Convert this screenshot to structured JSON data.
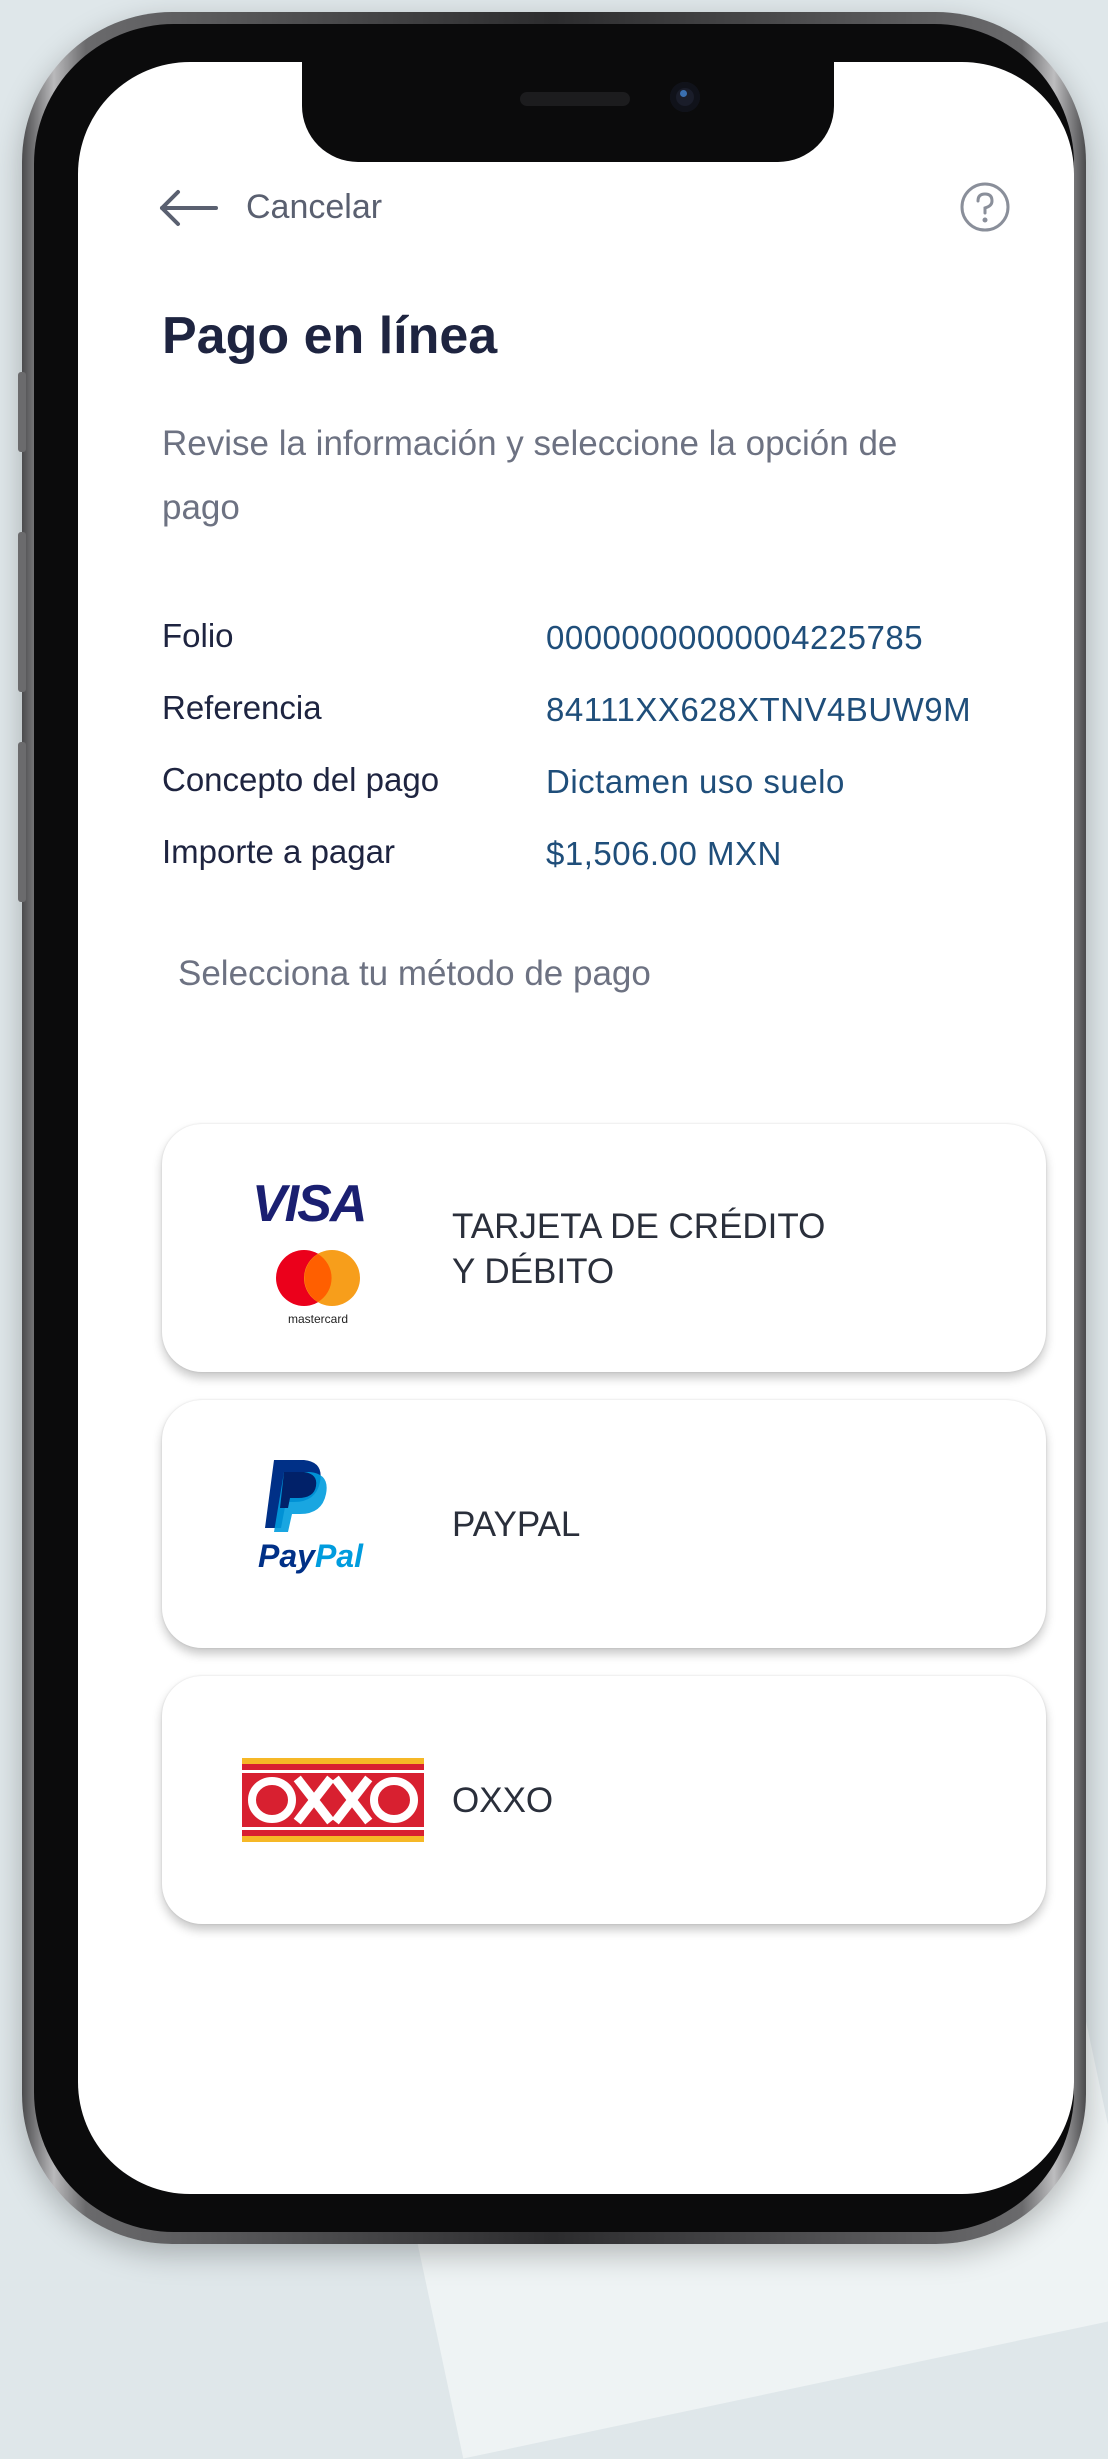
{
  "header": {
    "cancel_label": "Cancelar",
    "back_icon": "arrow-left-icon",
    "help_icon": "question-circle-icon"
  },
  "page": {
    "title": "Pago en línea",
    "subtitle": "Revise la información y seleccione la opción de pago"
  },
  "details": [
    {
      "label": "Folio",
      "value": "00000000000004225785"
    },
    {
      "label": "Referencia",
      "value": "84111XX628XTNV4BUW9M"
    },
    {
      "label": "Concepto del pago",
      "value": "Dictamen uso suelo"
    },
    {
      "label": "Importe a pagar",
      "value": "$1,506.00 MXN"
    }
  ],
  "methods_label": "Selecciona tu método de pago",
  "methods": [
    {
      "line1": "TARJETA DE CRÉDITO",
      "line2": "Y DÉBITO",
      "logo_text_visa": "VISA",
      "logo_text_mc": "mastercard"
    },
    {
      "line1": "PAYPAL",
      "logo_text": "PayPal"
    },
    {
      "line1": "OXXO",
      "logo_text": "OXXO"
    }
  ],
  "colors": {
    "primary_text": "#1e2440",
    "value_text": "#1f4e7a",
    "visa_blue": "#1a1f71",
    "mc_red": "#eb001b",
    "mc_orange": "#f79e1b",
    "paypal_dark": "#003087",
    "paypal_light": "#009cde",
    "oxxo_red": "#d82030",
    "oxxo_yellow": "#f6b826"
  }
}
